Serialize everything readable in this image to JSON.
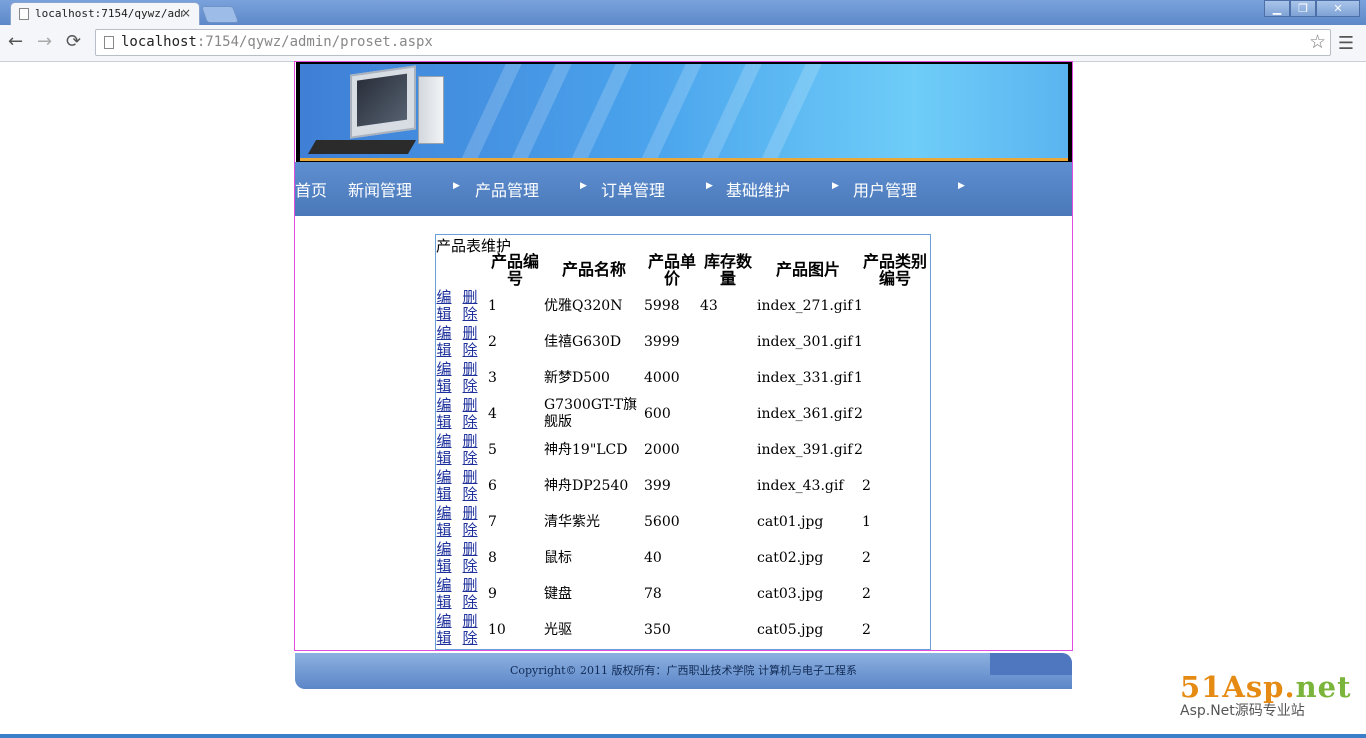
{
  "browser": {
    "tab_title": "localhost:7154/qywz/adm",
    "tab_close": "×",
    "url_host": "localhost",
    "url_rest": ":7154/qywz/admin/proset.aspx",
    "win_min": "▁",
    "win_restore": "❐",
    "win_close": "✕"
  },
  "nav": {
    "items": [
      "首页",
      "新闻管理",
      "产品管理",
      "订单管理",
      "基础维护",
      "用户管理"
    ]
  },
  "grid": {
    "caption": "产品表维护",
    "headers": [
      "产品编号",
      "产品名称",
      "产品单价",
      "库存数量",
      "产品图片",
      "产品类别编号"
    ],
    "edit_label": "编辑",
    "delete_label": "删除",
    "rows": [
      {
        "id": "1",
        "name": "优雅Q320N",
        "price": "5998",
        "stock": "43",
        "image": "index_271.gif",
        "cat": "1"
      },
      {
        "id": "2",
        "name": "佳禧G630D",
        "price": "3999",
        "stock": "",
        "image": "index_301.gif",
        "cat": "1"
      },
      {
        "id": "3",
        "name": "新梦D500",
        "price": "4000",
        "stock": "",
        "image": "index_331.gif",
        "cat": "1"
      },
      {
        "id": "4",
        "name": "G7300GT-T旗舰版",
        "price": "600",
        "stock": "",
        "image": "index_361.gif",
        "cat": "2"
      },
      {
        "id": "5",
        "name": "神舟19\"LCD",
        "price": "2000",
        "stock": "",
        "image": "index_391.gif",
        "cat": "2"
      },
      {
        "id": "6",
        "name": "神舟DP2540",
        "price": "399",
        "stock": "",
        "image": "index_43.gif",
        "cat": "2"
      },
      {
        "id": "7",
        "name": "清华紫光",
        "price": "5600",
        "stock": "",
        "image": "cat01.jpg",
        "cat": "1"
      },
      {
        "id": "8",
        "name": "鼠标",
        "price": "40",
        "stock": "",
        "image": "cat02.jpg",
        "cat": "2"
      },
      {
        "id": "9",
        "name": "键盘",
        "price": "78",
        "stock": "",
        "image": "cat03.jpg",
        "cat": "2"
      },
      {
        "id": "10",
        "name": "光驱",
        "price": "350",
        "stock": "",
        "image": "cat05.jpg",
        "cat": "2"
      }
    ]
  },
  "footer": {
    "copyright": "Copyright© 2011 版权所有：广西职业技术学院 计算机与电子工程系"
  },
  "watermark": {
    "brand_a": "51Asp.",
    "brand_b": "net",
    "tagline": "Asp.Net源码专业站"
  }
}
